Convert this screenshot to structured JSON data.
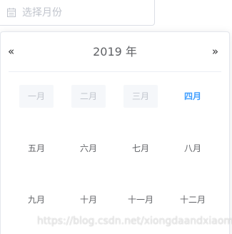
{
  "input": {
    "placeholder": "选择月份",
    "icon": "calendar-icon"
  },
  "panel": {
    "prev_year_icon": "«",
    "next_year_icon": "»",
    "year_label": "2019 年",
    "months": [
      {
        "label": "一月",
        "state": "disabled"
      },
      {
        "label": "二月",
        "state": "disabled"
      },
      {
        "label": "三月",
        "state": "disabled"
      },
      {
        "label": "四月",
        "state": "today"
      },
      {
        "label": "五月",
        "state": "normal"
      },
      {
        "label": "六月",
        "state": "normal"
      },
      {
        "label": "七月",
        "state": "normal"
      },
      {
        "label": "八月",
        "state": "normal"
      },
      {
        "label": "九月",
        "state": "normal"
      },
      {
        "label": "十月",
        "state": "normal"
      },
      {
        "label": "十一月",
        "state": "normal"
      },
      {
        "label": "十二月",
        "state": "normal"
      }
    ]
  },
  "colors": {
    "accent": "#409eff",
    "disabled_bg": "#f5f7fa",
    "disabled_text": "#c0c4cc",
    "text": "#606266"
  },
  "watermark": "https://blog.csdn.net/xiongdaandxiaomi"
}
